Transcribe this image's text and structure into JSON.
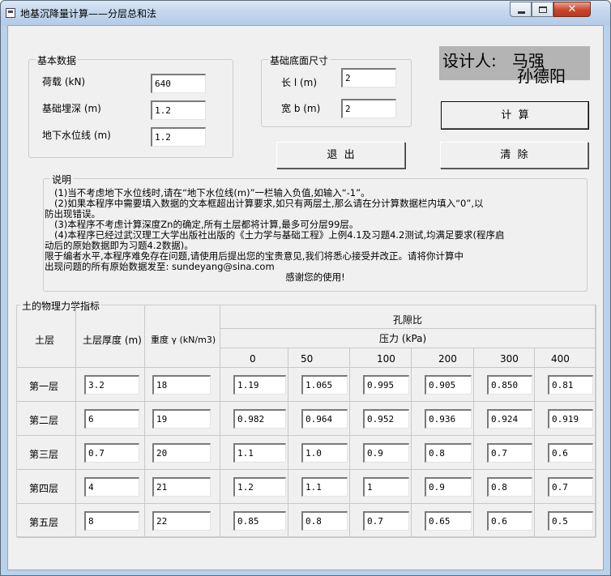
{
  "window": {
    "title": "地基沉降量计算——分层总和法"
  },
  "basic": {
    "group_title": "基本数据",
    "load_label": "荷载 (kN)",
    "load_value": "640",
    "depth_label": "基础埋深 (m)",
    "depth_value": "1.2",
    "water_label": "地下水位线 (m)",
    "water_value": "1.2"
  },
  "base_size": {
    "group_title": "基础底面尺寸",
    "length_label": "长 l (m)",
    "length_value": "2",
    "width_label": "宽 b (m)",
    "width_value": "2"
  },
  "designer": {
    "label": "设计人:",
    "name1": "马强",
    "name2": "孙德阳"
  },
  "buttons": {
    "calc": "计  算",
    "exit": "退  出",
    "clear": "清  除"
  },
  "notes": {
    "group_title": "说明",
    "lines": [
      "(1)当不考虑地下水位线时,请在“地下水位线(m)”一栏输入负值,如输入“-1”。",
      "(2)如果本程序中需要填入数据的文本框超出计算要求,如只有两层土,那么请在分计算数据栏内填入“0”,以",
      "防出现错误。",
      "(3)本程序不考虑计算深度Zn的确定,所有土层都将计算,最多可分层99层。",
      "(4)本程序已经过武汉理工大学出版社出版的《土力学与基础工程》上例4.1及习题4.2测试,均满足要求(程序启",
      "动后的原始数据即为习题4.2数据)。",
      "      限于编者水平,本程序难免存在问题,请使用后提出您的宝贵意见,我们将悉心接受并改正。请将你计算中",
      "出现问题的所有原始数据发至: sundeyang@sina.com",
      "感谢您的使用!"
    ]
  },
  "soil": {
    "group_title": "土的物理力学指标",
    "col_layer": "土层",
    "col_thickness": "土层厚度 (m)",
    "col_unit_weight": "重度 γ (kN/m3)",
    "col_void_ratio": "孔隙比",
    "col_pressure": "压力 (kPa)",
    "pressures": [
      "0",
      "50",
      "100",
      "200",
      "300",
      "400"
    ],
    "rows": [
      {
        "name": "第一层",
        "thickness": "3.2",
        "weight": "18",
        "e": [
          "1.19",
          "1.065",
          "0.995",
          "0.905",
          "0.850",
          "0.81"
        ]
      },
      {
        "name": "第二层",
        "thickness": "6",
        "weight": "19",
        "e": [
          "0.982",
          "0.964",
          "0.952",
          "0.936",
          "0.924",
          "0.919"
        ]
      },
      {
        "name": "第三层",
        "thickness": "0.7",
        "weight": "20",
        "e": [
          "1.1",
          "1.0",
          "0.9",
          "0.8",
          "0.7",
          "0.6"
        ]
      },
      {
        "name": "第四层",
        "thickness": "4",
        "weight": "21",
        "e": [
          "1.2",
          "1.1",
          "1",
          "0.9",
          "0.8",
          "0.7"
        ]
      },
      {
        "name": "第五层",
        "thickness": "8",
        "weight": "22",
        "e": [
          "0.85",
          "0.8",
          "0.7",
          "0.65",
          "0.6",
          "0.5"
        ]
      }
    ]
  }
}
